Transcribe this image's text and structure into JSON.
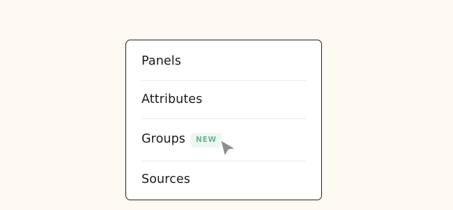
{
  "menu": {
    "items": [
      {
        "label": "Panels"
      },
      {
        "label": "Attributes"
      },
      {
        "label": "Groups",
        "badge": "NEW"
      },
      {
        "label": "Sources"
      }
    ]
  },
  "colors": {
    "background": "#fdf9f3",
    "border": "#222222",
    "badge_bg": "#eef6f1",
    "badge_text": "#6ab495",
    "cursor": "#8f8f8f"
  },
  "icons": {
    "cursor": "cursor-arrow-icon"
  }
}
